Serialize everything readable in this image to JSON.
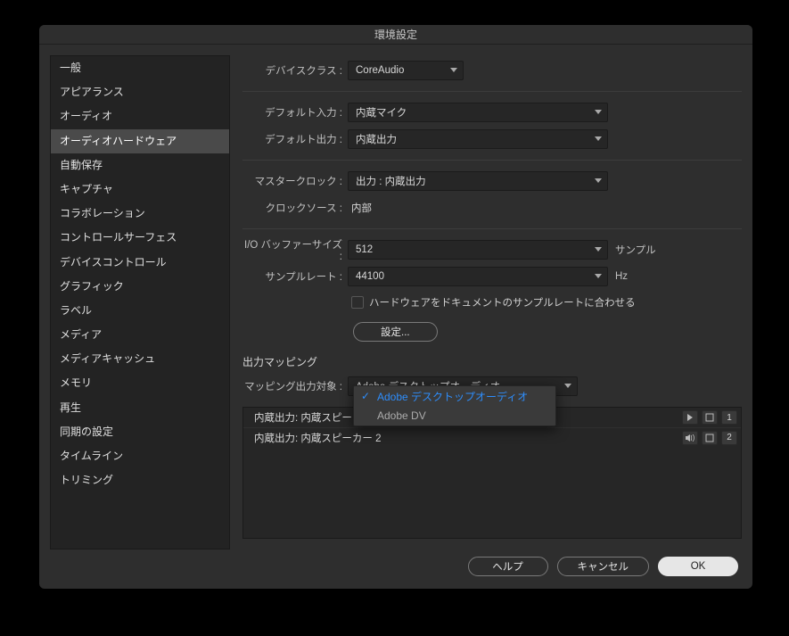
{
  "window": {
    "title": "環境設定"
  },
  "sidebar": {
    "items": [
      "一般",
      "アピアランス",
      "オーディオ",
      "オーディオハードウェア",
      "自動保存",
      "キャプチャ",
      "コラボレーション",
      "コントロールサーフェス",
      "デバイスコントロール",
      "グラフィック",
      "ラベル",
      "メディア",
      "メディアキャッシュ",
      "メモリ",
      "再生",
      "同期の設定",
      "タイムライン",
      "トリミング"
    ],
    "selected_index": 3
  },
  "labels": {
    "device_class": "デバイスクラス :",
    "default_input": "デフォルト入力 :",
    "default_output": "デフォルト出力 :",
    "master_clock": "マスタークロック :",
    "clock_source": "クロックソース :",
    "io_buffer": "I/O バッファーサイズ :",
    "sample_rate": "サンプルレート :",
    "match_hw": "ハードウェアをドキュメントのサンプルレートに合わせる",
    "settings_btn": "設定...",
    "output_mapping_title": "出力マッピング",
    "mapping_target": "マッピング出力対象 :",
    "io_unit": "サンプル",
    "sr_unit": "Hz"
  },
  "values": {
    "device_class": "CoreAudio",
    "default_input": "内蔵マイク",
    "default_output": "内蔵出力",
    "master_clock": "出力 : 内蔵出力",
    "clock_source": "内部",
    "io_buffer": "512",
    "sample_rate": "44100",
    "mapping_target": "Adobe デスクトップオーディオ"
  },
  "mapping_menu": {
    "items": [
      "Adobe デスクトップオーディオ",
      "Adobe DV"
    ],
    "selected_index": 0
  },
  "map_rows": [
    {
      "label": "内蔵出力: 内蔵スピー",
      "num": "1",
      "icon": "play"
    },
    {
      "label": "内蔵出力: 内蔵スピーカー 2",
      "num": "2",
      "icon": "speaker"
    }
  ],
  "footer": {
    "help": "ヘルプ",
    "cancel": "キャンセル",
    "ok": "OK"
  }
}
